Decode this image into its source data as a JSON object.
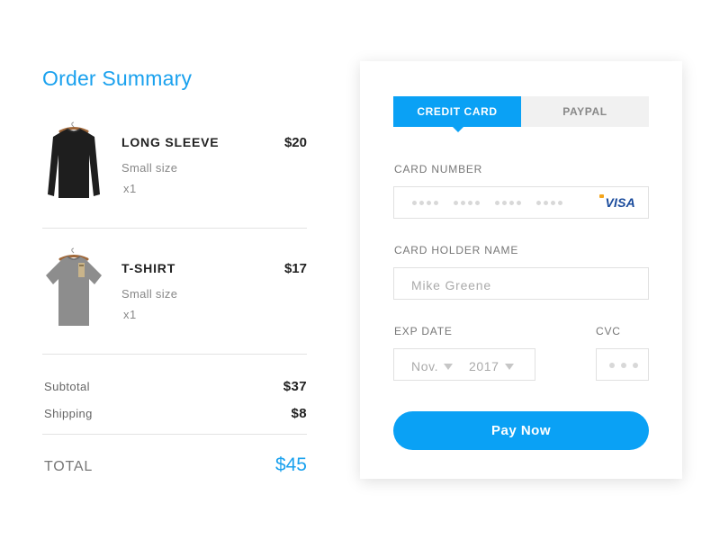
{
  "summary": {
    "title": "Order Summary",
    "items": [
      {
        "name": "LONG SLEEVE",
        "price": "$20",
        "size": "Small size",
        "qty": "x1",
        "image": "long-sleeve-shirt-image",
        "color": "#1e1e1e"
      },
      {
        "name": "T-SHIRT",
        "price": "$17",
        "size": "Small size",
        "qty": "x1",
        "image": "t-shirt-image",
        "color": "#8d8d8d"
      }
    ],
    "subtotal_label": "Subtotal",
    "subtotal_value": "$37",
    "shipping_label": "Shipping",
    "shipping_value": "$8",
    "total_label": "TOTAL",
    "total_value": "$45"
  },
  "payment": {
    "tabs": [
      {
        "label": "CREDIT CARD",
        "active": true
      },
      {
        "label": "PAYPAL",
        "active": false
      }
    ],
    "card_number_label": "CARD NUMBER",
    "card_brand": "VISA",
    "card_holder_label": "CARD HOLDER NAME",
    "card_holder_value": "Mike Greene",
    "exp_label": "EXP DATE",
    "exp_month": "Nov.",
    "exp_year": "2017",
    "cvc_label": "CVC",
    "pay_button": "Pay Now"
  },
  "colors": {
    "accent": "#0aa1f5",
    "visa_blue": "#1a4b9c"
  }
}
